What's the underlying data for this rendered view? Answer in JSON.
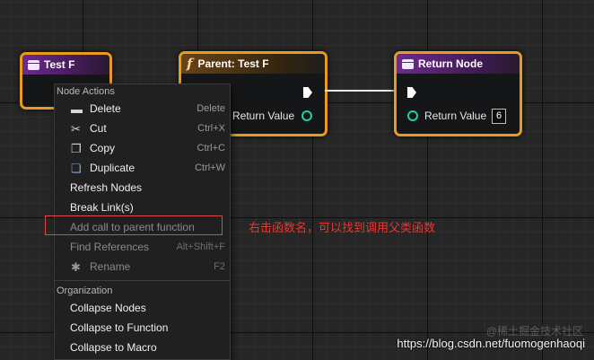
{
  "graph": {
    "nodes": {
      "test_f": {
        "title": "Test F"
      },
      "parent": {
        "glyph": "f",
        "title": "Parent: Test F",
        "pin_label": "Return Value"
      },
      "return": {
        "title": "Return Node",
        "pin_label": "Return Value",
        "value": "6"
      }
    }
  },
  "context_menu": {
    "sections": {
      "node_actions": "Node Actions",
      "organization": "Organization"
    },
    "items": [
      {
        "label": "Delete",
        "shortcut": "Delete",
        "icon": "trash-icon",
        "enabled": true
      },
      {
        "label": "Cut",
        "shortcut": "Ctrl+X",
        "icon": "scissors-icon",
        "enabled": true
      },
      {
        "label": "Copy",
        "shortcut": "Ctrl+C",
        "icon": "copy-icon",
        "enabled": true
      },
      {
        "label": "Duplicate",
        "shortcut": "Ctrl+W",
        "icon": "duplicate-icon",
        "enabled": true
      },
      {
        "label": "Refresh Nodes",
        "shortcut": "",
        "enabled": true
      },
      {
        "label": "Break Link(s)",
        "shortcut": "",
        "enabled": true
      },
      {
        "label": "Add call to parent function",
        "shortcut": "",
        "enabled": false
      },
      {
        "label": "Find References",
        "shortcut": "Alt+Shift+F",
        "enabled": false
      },
      {
        "label": "Rename",
        "shortcut": "F2",
        "icon": "rename-icon",
        "enabled": false
      }
    ],
    "organization_items": [
      {
        "label": "Collapse Nodes"
      },
      {
        "label": "Collapse to Function"
      },
      {
        "label": "Collapse to Macro"
      }
    ]
  },
  "annotation": {
    "text": "右击函数名，可以找到调用父类函数",
    "color": "#e23a32"
  },
  "watermark": {
    "text": "https://blog.csdn.net/fuomogenhaoqi",
    "faint_text": "@稀土掘金技术社区"
  },
  "colors": {
    "node_border": "#e89b1c",
    "pin_data": "#1fd1a6",
    "background": "#262626"
  }
}
